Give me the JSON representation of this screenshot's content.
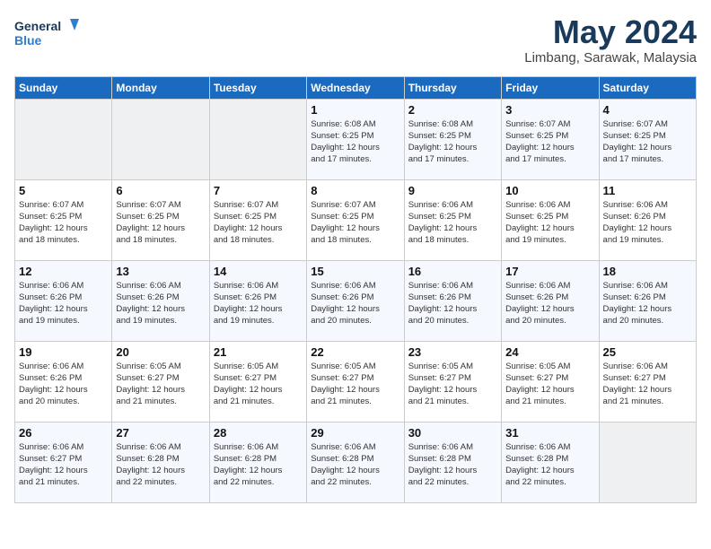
{
  "header": {
    "logo_line1": "General",
    "logo_line2": "Blue",
    "month_title": "May 2024",
    "location": "Limbang, Sarawak, Malaysia"
  },
  "days_of_week": [
    "Sunday",
    "Monday",
    "Tuesday",
    "Wednesday",
    "Thursday",
    "Friday",
    "Saturday"
  ],
  "weeks": [
    [
      {
        "day": "",
        "detail": ""
      },
      {
        "day": "",
        "detail": ""
      },
      {
        "day": "",
        "detail": ""
      },
      {
        "day": "1",
        "detail": "Sunrise: 6:08 AM\nSunset: 6:25 PM\nDaylight: 12 hours\nand 17 minutes."
      },
      {
        "day": "2",
        "detail": "Sunrise: 6:08 AM\nSunset: 6:25 PM\nDaylight: 12 hours\nand 17 minutes."
      },
      {
        "day": "3",
        "detail": "Sunrise: 6:07 AM\nSunset: 6:25 PM\nDaylight: 12 hours\nand 17 minutes."
      },
      {
        "day": "4",
        "detail": "Sunrise: 6:07 AM\nSunset: 6:25 PM\nDaylight: 12 hours\nand 17 minutes."
      }
    ],
    [
      {
        "day": "5",
        "detail": "Sunrise: 6:07 AM\nSunset: 6:25 PM\nDaylight: 12 hours\nand 18 minutes."
      },
      {
        "day": "6",
        "detail": "Sunrise: 6:07 AM\nSunset: 6:25 PM\nDaylight: 12 hours\nand 18 minutes."
      },
      {
        "day": "7",
        "detail": "Sunrise: 6:07 AM\nSunset: 6:25 PM\nDaylight: 12 hours\nand 18 minutes."
      },
      {
        "day": "8",
        "detail": "Sunrise: 6:07 AM\nSunset: 6:25 PM\nDaylight: 12 hours\nand 18 minutes."
      },
      {
        "day": "9",
        "detail": "Sunrise: 6:06 AM\nSunset: 6:25 PM\nDaylight: 12 hours\nand 18 minutes."
      },
      {
        "day": "10",
        "detail": "Sunrise: 6:06 AM\nSunset: 6:25 PM\nDaylight: 12 hours\nand 19 minutes."
      },
      {
        "day": "11",
        "detail": "Sunrise: 6:06 AM\nSunset: 6:26 PM\nDaylight: 12 hours\nand 19 minutes."
      }
    ],
    [
      {
        "day": "12",
        "detail": "Sunrise: 6:06 AM\nSunset: 6:26 PM\nDaylight: 12 hours\nand 19 minutes."
      },
      {
        "day": "13",
        "detail": "Sunrise: 6:06 AM\nSunset: 6:26 PM\nDaylight: 12 hours\nand 19 minutes."
      },
      {
        "day": "14",
        "detail": "Sunrise: 6:06 AM\nSunset: 6:26 PM\nDaylight: 12 hours\nand 19 minutes."
      },
      {
        "day": "15",
        "detail": "Sunrise: 6:06 AM\nSunset: 6:26 PM\nDaylight: 12 hours\nand 20 minutes."
      },
      {
        "day": "16",
        "detail": "Sunrise: 6:06 AM\nSunset: 6:26 PM\nDaylight: 12 hours\nand 20 minutes."
      },
      {
        "day": "17",
        "detail": "Sunrise: 6:06 AM\nSunset: 6:26 PM\nDaylight: 12 hours\nand 20 minutes."
      },
      {
        "day": "18",
        "detail": "Sunrise: 6:06 AM\nSunset: 6:26 PM\nDaylight: 12 hours\nand 20 minutes."
      }
    ],
    [
      {
        "day": "19",
        "detail": "Sunrise: 6:06 AM\nSunset: 6:26 PM\nDaylight: 12 hours\nand 20 minutes."
      },
      {
        "day": "20",
        "detail": "Sunrise: 6:05 AM\nSunset: 6:27 PM\nDaylight: 12 hours\nand 21 minutes."
      },
      {
        "day": "21",
        "detail": "Sunrise: 6:05 AM\nSunset: 6:27 PM\nDaylight: 12 hours\nand 21 minutes."
      },
      {
        "day": "22",
        "detail": "Sunrise: 6:05 AM\nSunset: 6:27 PM\nDaylight: 12 hours\nand 21 minutes."
      },
      {
        "day": "23",
        "detail": "Sunrise: 6:05 AM\nSunset: 6:27 PM\nDaylight: 12 hours\nand 21 minutes."
      },
      {
        "day": "24",
        "detail": "Sunrise: 6:05 AM\nSunset: 6:27 PM\nDaylight: 12 hours\nand 21 minutes."
      },
      {
        "day": "25",
        "detail": "Sunrise: 6:06 AM\nSunset: 6:27 PM\nDaylight: 12 hours\nand 21 minutes."
      }
    ],
    [
      {
        "day": "26",
        "detail": "Sunrise: 6:06 AM\nSunset: 6:27 PM\nDaylight: 12 hours\nand 21 minutes."
      },
      {
        "day": "27",
        "detail": "Sunrise: 6:06 AM\nSunset: 6:28 PM\nDaylight: 12 hours\nand 22 minutes."
      },
      {
        "day": "28",
        "detail": "Sunrise: 6:06 AM\nSunset: 6:28 PM\nDaylight: 12 hours\nand 22 minutes."
      },
      {
        "day": "29",
        "detail": "Sunrise: 6:06 AM\nSunset: 6:28 PM\nDaylight: 12 hours\nand 22 minutes."
      },
      {
        "day": "30",
        "detail": "Sunrise: 6:06 AM\nSunset: 6:28 PM\nDaylight: 12 hours\nand 22 minutes."
      },
      {
        "day": "31",
        "detail": "Sunrise: 6:06 AM\nSunset: 6:28 PM\nDaylight: 12 hours\nand 22 minutes."
      },
      {
        "day": "",
        "detail": ""
      }
    ]
  ]
}
